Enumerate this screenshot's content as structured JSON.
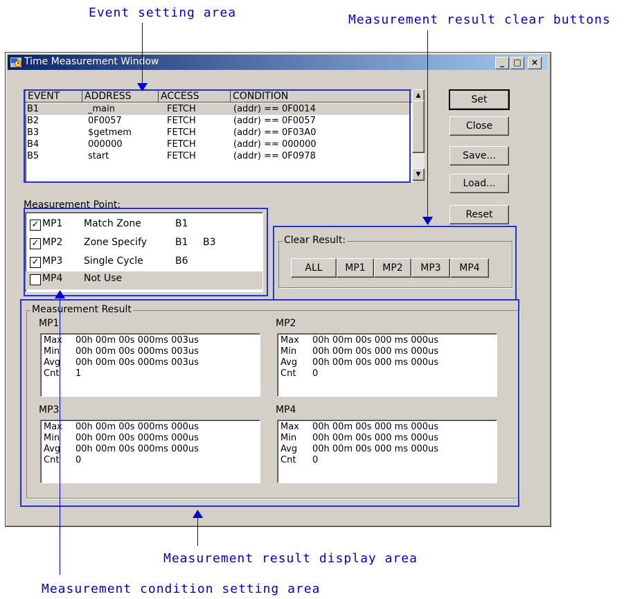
{
  "callouts": {
    "event_setting": "Event setting area",
    "clear_buttons": "Measurement result clear buttons",
    "display_area": "Measurement result display area",
    "condition_area": "Measurement condition setting area"
  },
  "window": {
    "title": "Time Measurement Window",
    "minimize": "_",
    "maximize": "□",
    "close": "×"
  },
  "events": {
    "headers": [
      "EVENT",
      "ADDRESS",
      "ACCESS",
      "CONDITION"
    ],
    "rows": [
      {
        "event": "B1",
        "address": "_main",
        "access": "FETCH",
        "condition": "(addr) == 0F0014"
      },
      {
        "event": "B2",
        "address": "0F0057",
        "access": "FETCH",
        "condition": "(addr) == 0F0057"
      },
      {
        "event": "B3",
        "address": "$getmem",
        "access": "FETCH",
        "condition": "(addr) == 0F03A0"
      },
      {
        "event": "B4",
        "address": "000000",
        "access": "FETCH",
        "condition": "(addr) == 000000"
      },
      {
        "event": "B5",
        "address": "start",
        "access": "FETCH",
        "condition": "(addr) == 0F0978"
      }
    ]
  },
  "buttons": {
    "set": "Set",
    "close": "Close",
    "save": "Save...",
    "load": "Load...",
    "reset": "Reset"
  },
  "measurement_point": {
    "label": "Measurement Point:",
    "items": [
      {
        "checked": true,
        "name": "MP1",
        "mode": "Match Zone",
        "start": "B1",
        "end": ""
      },
      {
        "checked": true,
        "name": "MP2",
        "mode": "Zone Specify",
        "start": "B1",
        "end": "B3"
      },
      {
        "checked": true,
        "name": "MP3",
        "mode": "Single Cycle",
        "start": "B6",
        "end": ""
      },
      {
        "checked": false,
        "name": "MP4",
        "mode": "Not Use",
        "start": "",
        "end": ""
      }
    ]
  },
  "clear_result": {
    "label": "Clear Result:",
    "buttons": [
      "ALL",
      "MP1",
      "MP2",
      "MP3",
      "MP4"
    ]
  },
  "measurement_result": {
    "label": "Measurement Result",
    "panels": [
      {
        "name": "MP1",
        "rows": [
          {
            "k": "Max",
            "v": "00h 00m 00s 000ms 003us"
          },
          {
            "k": "Min",
            "v": "00h 00m 00s 000ms 003us"
          },
          {
            "k": "Avg",
            "v": "00h 00m 00s 000ms 003us"
          },
          {
            "k": "Cnt",
            "v": "1"
          }
        ]
      },
      {
        "name": "MP2",
        "rows": [
          {
            "k": "Max",
            "v": "00h 00m 00s 000 ms 000us"
          },
          {
            "k": "Min",
            "v": "00h 00m 00s 000 ms 000us"
          },
          {
            "k": "Avg",
            "v": "00h 00m 00s 000 ms 000us"
          },
          {
            "k": "Cnt",
            "v": "0"
          }
        ]
      },
      {
        "name": "MP3",
        "rows": [
          {
            "k": "Max",
            "v": "00h 00m 00s 000ms 000us"
          },
          {
            "k": "Min",
            "v": "00h 00m 00s 000ms 000us"
          },
          {
            "k": "Avg",
            "v": "00h 00m 00s 000ms 000us"
          },
          {
            "k": "Cnt",
            "v": "0"
          }
        ]
      },
      {
        "name": "MP4",
        "rows": [
          {
            "k": "Max",
            "v": "00h 00m 00s 000 ms 000us"
          },
          {
            "k": "Min",
            "v": "00h 00m 00s 000 ms 000us"
          },
          {
            "k": "Avg",
            "v": "00h 00m 00s 000 ms 000us"
          },
          {
            "k": "Cnt",
            "v": "0"
          }
        ]
      }
    ]
  },
  "colors": {
    "annotation": "#2030e0",
    "titlebar_start": "#0a246a",
    "titlebar_end": "#a6caf0",
    "face": "#d4d0c8"
  }
}
